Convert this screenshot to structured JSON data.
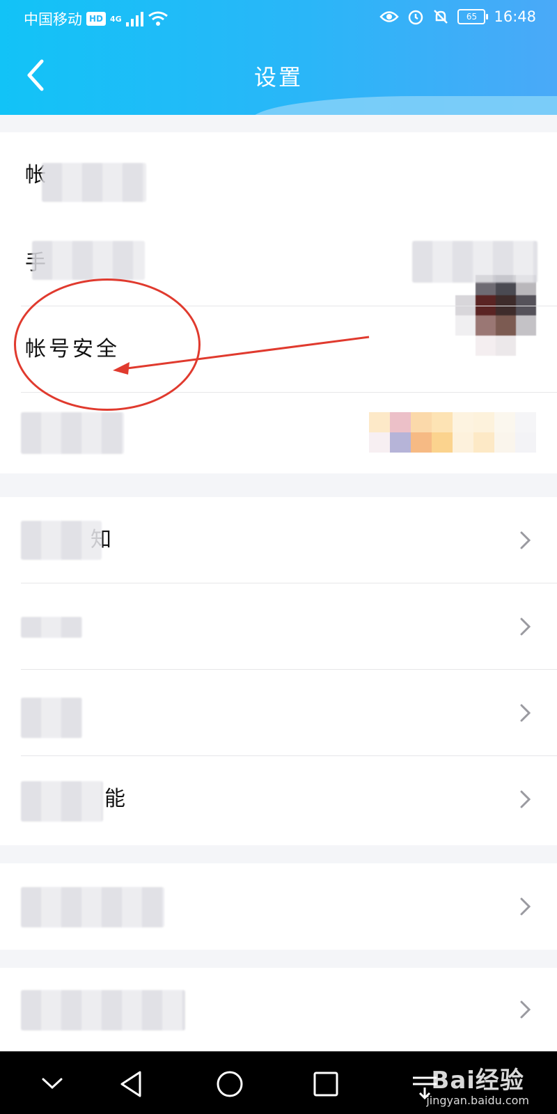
{
  "status_bar": {
    "carrier": "中国移动",
    "hd": "HD",
    "network": "4G",
    "battery": "65",
    "time": "16:48"
  },
  "header": {
    "title": "设置"
  },
  "section1": {
    "rows": [
      {
        "label": "帐"
      },
      {
        "label": "手"
      },
      {
        "label": "帐号安全"
      },
      {
        "label": ""
      }
    ]
  },
  "section2": {
    "rows": [
      {
        "label": "知"
      },
      {
        "label": ""
      },
      {
        "label": ""
      },
      {
        "label": "能"
      }
    ]
  },
  "section3": {
    "rows": [
      {
        "label": ""
      }
    ]
  },
  "section4": {
    "rows": [
      {
        "label": ""
      }
    ]
  },
  "watermark": {
    "logo": "Bai经验",
    "url": "jingyan.baidu.com"
  },
  "colors": {
    "header_gradient_start": "#12c3f7",
    "header_gradient_end": "#4aa9f8",
    "annotation_red": "#e03a2e"
  },
  "icons": {
    "back": "chevron-left-icon",
    "row_arrow": "chevron-right-icon",
    "nav_down": "chevron-down-icon",
    "nav_back": "triangle-back-icon",
    "nav_home": "circle-home-icon",
    "nav_recent": "square-recent-icon"
  }
}
